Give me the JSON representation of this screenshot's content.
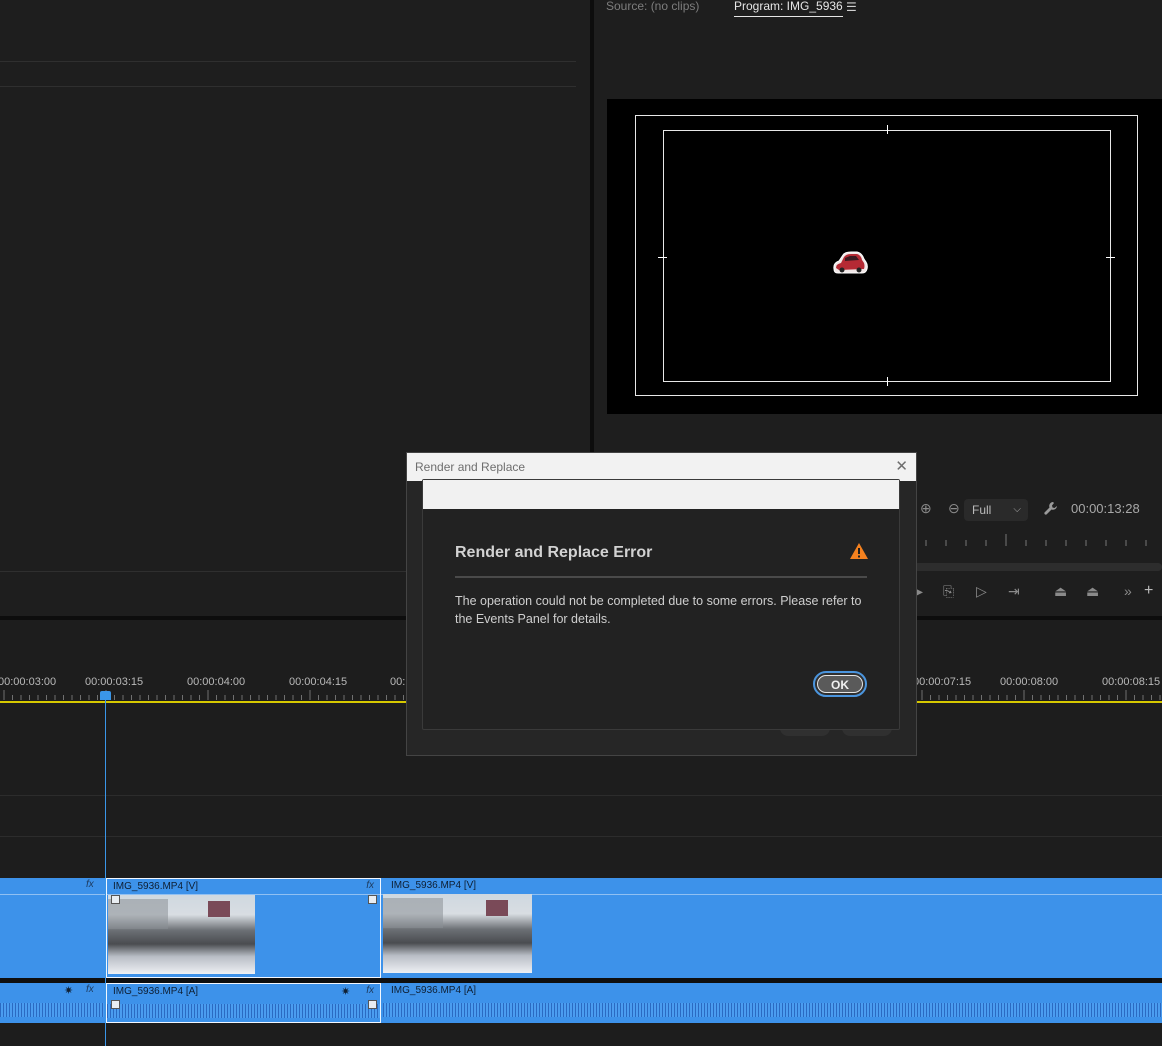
{
  "source_monitor": {
    "tab_label": "Source: (no clips)"
  },
  "program_monitor": {
    "tab_label": "Program: IMG_5936",
    "menu_icon": "hamburger-icon",
    "zoom": "Full",
    "timecode": "00:00:13:28"
  },
  "timeline": {
    "ruler_labels": [
      "00:00:03:00",
      "00:00:03:15",
      "00:00:04:00",
      "00:00:04:15",
      "00:",
      "00:00:07:15",
      "00:00:08:00",
      "00:00:08:15"
    ],
    "playhead_time": "00:00:03:15",
    "video_track": {
      "clips": [
        {
          "label": "IMG_5936.MP4 [V]",
          "selected": true
        },
        {
          "label": "IMG_5936.MP4 [V]",
          "selected": false
        }
      ]
    },
    "audio_track": {
      "clips": [
        {
          "label": "IMG_5936.MP4 [A]",
          "selected": true
        },
        {
          "label": "IMG_5936.MP4 [A]",
          "selected": false
        }
      ]
    },
    "fx_badge": "fx"
  },
  "outer_dialog": {
    "title": "Render and Replace",
    "close_icon": "close-icon"
  },
  "error_dialog": {
    "heading": "Render and Replace Error",
    "message": "The operation could not be completed due to some errors. Please refer to the Events Panel for details.",
    "ok_label": "OK",
    "warning_icon": "warning-icon",
    "warning_color": "#f4811f"
  },
  "colors": {
    "clip_blue": "#3d92ea",
    "playhead_blue": "#3a96e8",
    "work_area_yellow": "#d6c800"
  }
}
